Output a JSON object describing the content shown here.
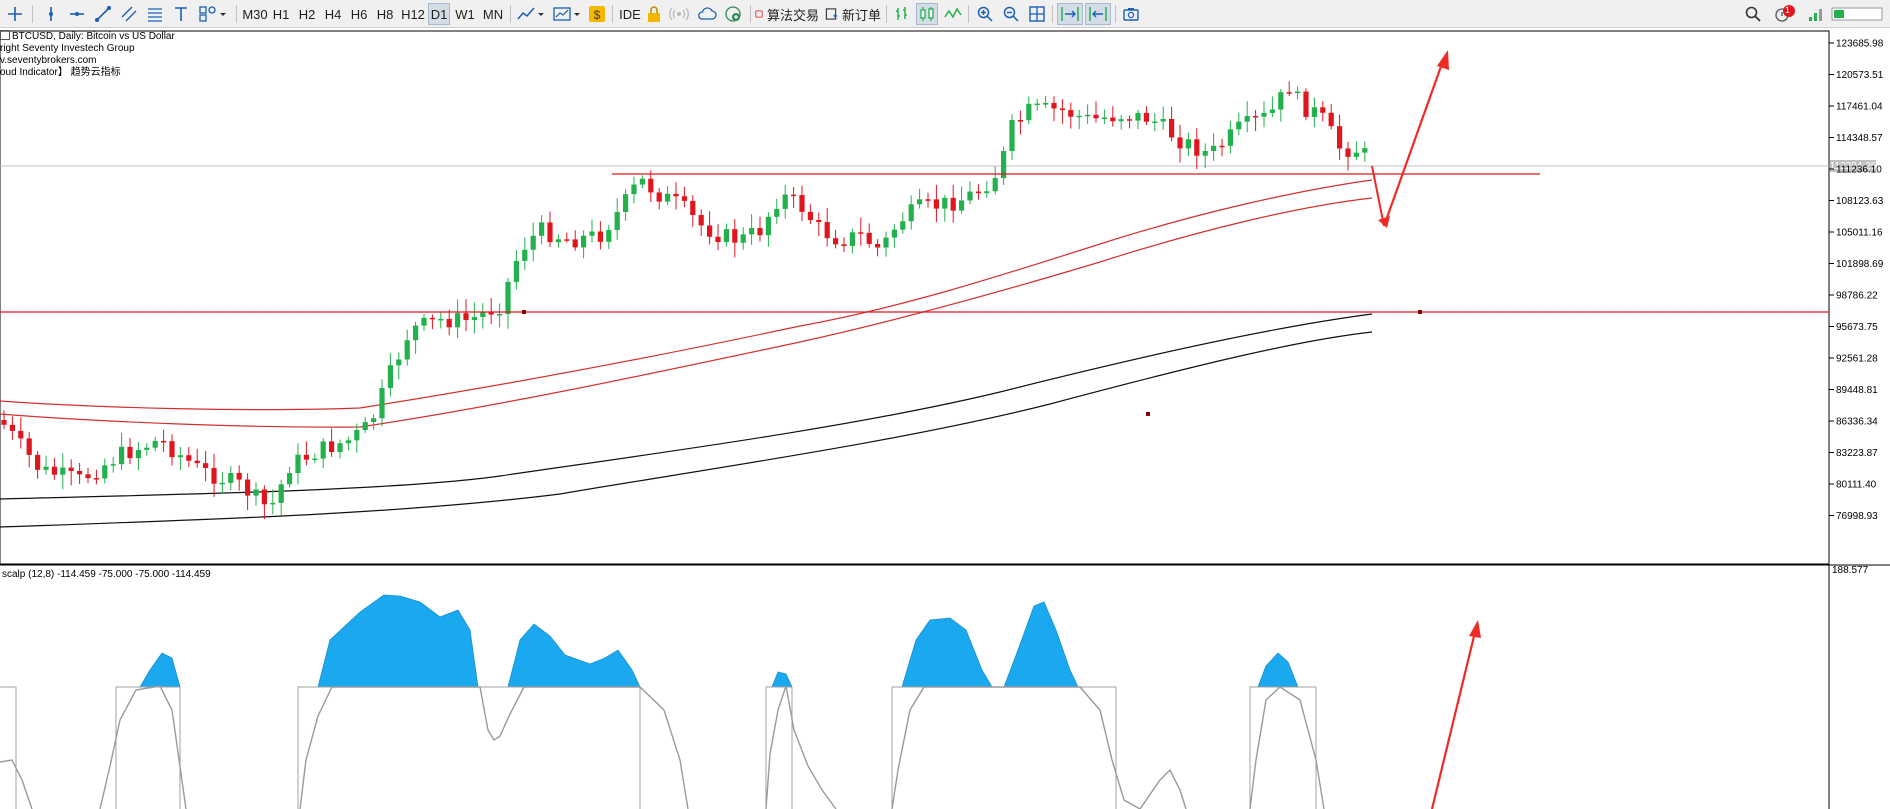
{
  "toolbar": {
    "timeframes": [
      "M30",
      "H1",
      "H2",
      "H4",
      "H6",
      "H8",
      "H12",
      "D1",
      "W1",
      "MN"
    ],
    "active_timeframe": "D1",
    "ide_label": "IDE",
    "algo_trading_label": "算法交易",
    "new_order_label": "新订单",
    "notification_count": "1"
  },
  "chart": {
    "info_lines": [
      "BTCUSD, Daily:  Bitcoin vs US Dollar",
      "right Seventy Investech Group",
      "v.seventybrokers.com",
      "oud Indicator】 趋势云指标"
    ],
    "price_axis": [
      "123685.98",
      "120573.51",
      "117461.04",
      "114348.57",
      "111236.10",
      "108123.63",
      "105011.16",
      "101898.69",
      "98786.22",
      "95673.75",
      "92561.28",
      "89448.81",
      "86336.34",
      "83223.87",
      "80111.40",
      "76998.93"
    ],
    "current_price": "112284.25",
    "indicator_label": "scalp (12,8) -114.459 -75.000 -75.000 -114.459",
    "indicator_axis_top": "188.577"
  },
  "colors": {
    "bull": "#22b14c",
    "bear": "#e0161e",
    "ma_red": "#d32f2f",
    "ma_black": "#111111",
    "arrow": "#ee2a24",
    "indicator_fill": "#1aa8ee",
    "indicator_line": "#9a9a9a"
  }
}
